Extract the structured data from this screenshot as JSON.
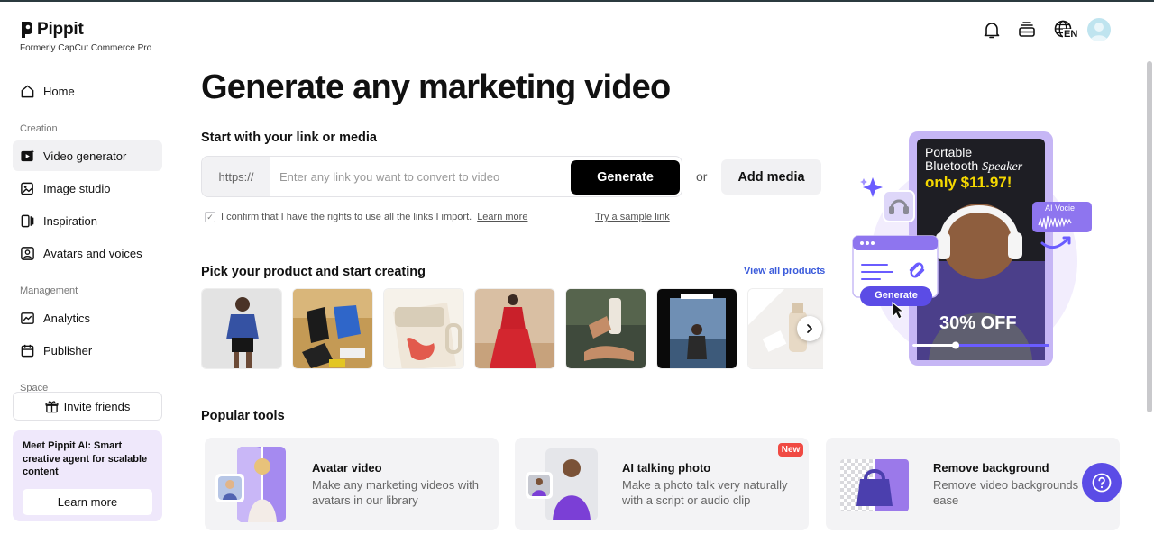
{
  "brand": {
    "name": "Pippit",
    "subtitle": "Formerly CapCut Commerce Pro"
  },
  "sidebar": {
    "home": "Home",
    "section_creation": "Creation",
    "creation_items": [
      "Video generator",
      "Image studio",
      "Inspiration",
      "Avatars and voices"
    ],
    "section_management": "Management",
    "management_items": [
      "Analytics",
      "Publisher"
    ],
    "section_space": "Space",
    "invite": "Invite friends",
    "promo_text": "Meet Pippit AI: Smart creative agent for scalable content",
    "promo_button": "Learn more"
  },
  "header": {
    "language": "EN"
  },
  "main": {
    "title": "Generate any marketing video",
    "link_heading": "Start with your link or media",
    "link_prefix": "https://",
    "link_placeholder": "Enter any link you want to convert to video",
    "generate": "Generate",
    "or": "or",
    "add_media": "Add media",
    "confirm_text": "I confirm that I have the rights to use all the links I import.",
    "confirm_link": "Learn more",
    "sample_link": "Try a sample link",
    "products_heading": "Pick your product and start creating",
    "view_all": "View all products",
    "tools_heading": "Popular tools"
  },
  "tools": [
    {
      "title": "Avatar video",
      "desc": "Make any marketing videos with avatars in our library"
    },
    {
      "title": "AI talking photo",
      "desc": "Make a photo talk very naturally with a script or audio clip",
      "badge": "New"
    },
    {
      "title": "Remove background",
      "desc": "Remove video backgrounds ease"
    }
  ],
  "hero": {
    "line1": "Portable",
    "line2": "Bluetooth",
    "line2b": "Speaker",
    "price": "only $11.97!",
    "discount": "30% OFF",
    "ai_voice": "AI Vocie",
    "generate": "Generate"
  },
  "colors": {
    "accent": "#5b4ce6",
    "purple_light": "#efe8fb",
    "price_yellow": "#f5d800",
    "link_blue": "#3b5bdb",
    "badge_red": "#f04a43"
  }
}
